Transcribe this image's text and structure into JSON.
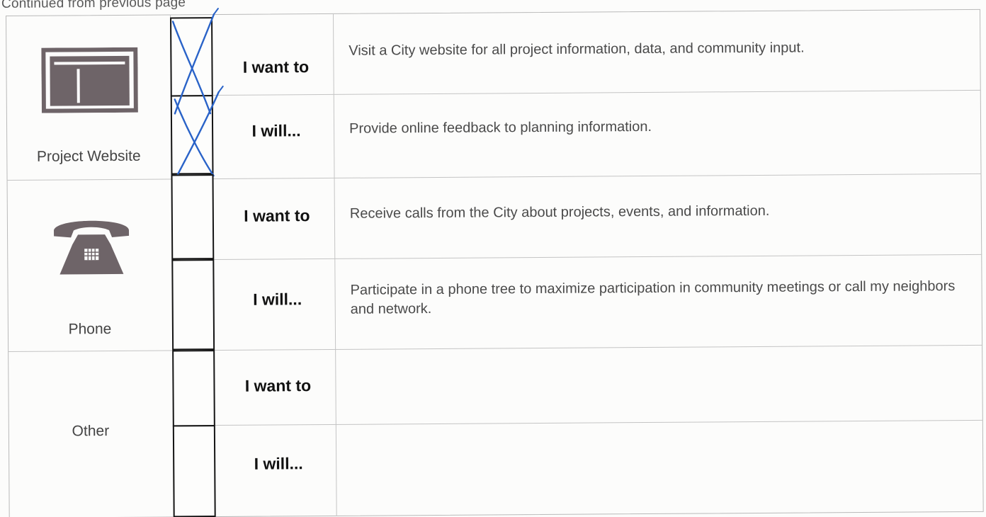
{
  "header": {
    "continued_text": "Continued from previous page"
  },
  "channels": [
    {
      "label": "Project Website",
      "icon": "website-icon",
      "rows": [
        {
          "prompt": "I want to",
          "statement": "Visit a City website for all project information, data, and community input.",
          "checked": true
        },
        {
          "prompt": "I will...",
          "statement": "Provide online feedback to planning information.",
          "checked": true
        }
      ]
    },
    {
      "label": "Phone",
      "icon": "telephone-icon",
      "rows": [
        {
          "prompt": "I want to",
          "statement": "Receive calls from the City about projects, events, and information.",
          "checked": false
        },
        {
          "prompt": "I will...",
          "statement": "Participate in a phone tree to maximize participation in community meetings or call my neighbors and network.",
          "checked": false
        }
      ]
    },
    {
      "label": "Other",
      "icon": "",
      "rows": [
        {
          "prompt": "I want to",
          "statement": "",
          "checked": false
        },
        {
          "prompt": "I will...",
          "statement": "",
          "checked": false
        }
      ]
    }
  ],
  "colors": {
    "ink": "#2a63c8",
    "icon": "#6e6468",
    "grid": "#c4c4c4"
  }
}
